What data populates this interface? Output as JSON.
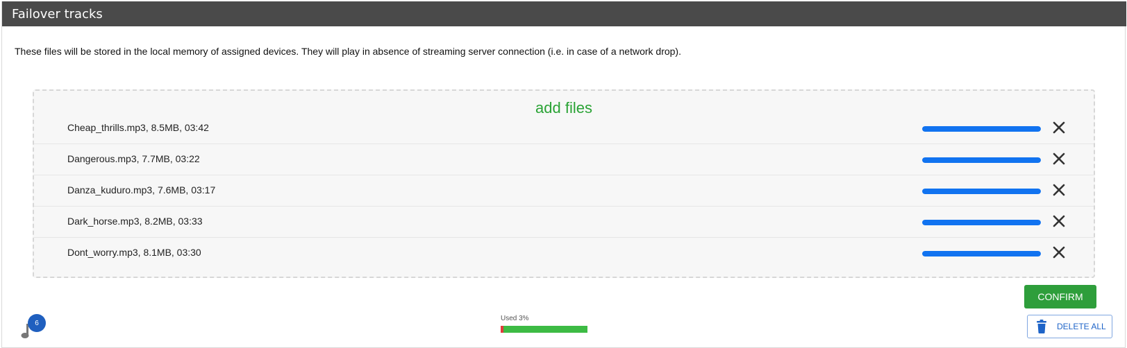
{
  "panel": {
    "title": "Failover tracks",
    "description": "These files will be stored in the local memory of assigned devices. They will play in absence of streaming server connection (i.e. in case of a network drop)."
  },
  "dropzone": {
    "add_files_label": "add files",
    "files": [
      {
        "label": "Cheap_thrills.mp3, 8.5MB, 03:42",
        "progress": 1.0
      },
      {
        "label": "Dangerous.mp3, 7.7MB, 03:22",
        "progress": 1.0
      },
      {
        "label": "Danza_kuduro.mp3, 7.6MB, 03:17",
        "progress": 1.0
      },
      {
        "label": "Dark_horse.mp3, 8.2MB, 03:33",
        "progress": 1.0
      },
      {
        "label": "Dont_worry.mp3, 8.1MB, 03:30",
        "progress": 1.0
      }
    ]
  },
  "actions": {
    "confirm_label": "CONFIRM",
    "delete_all_label": "DELETE ALL"
  },
  "storage": {
    "used_label": "Used 3%",
    "used_fraction": 0.03
  },
  "tracks_badge": {
    "count": "6"
  },
  "colors": {
    "header": "#4a4a4a",
    "accent_green": "#2aa335",
    "progress_blue": "#1173f0",
    "badge_blue": "#1f5fbf",
    "used_red": "#e03c3c"
  }
}
